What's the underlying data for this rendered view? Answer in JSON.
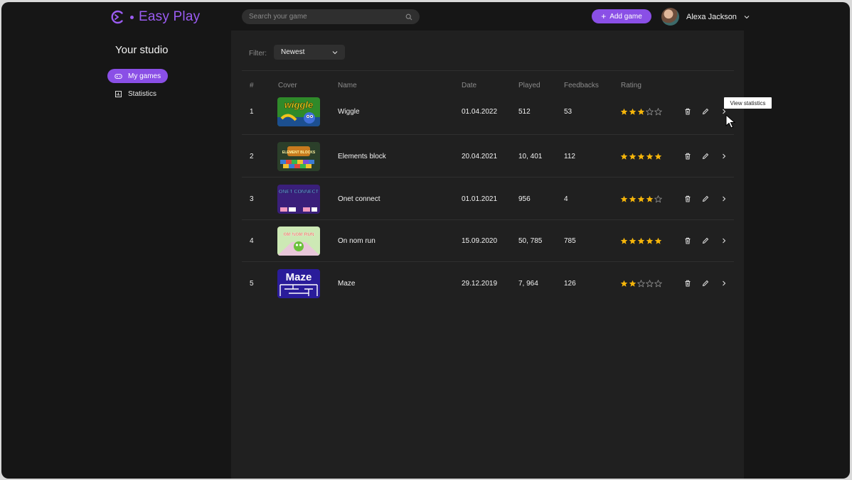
{
  "app": {
    "name": "Easy Play"
  },
  "header": {
    "search_placeholder": "Search your game",
    "add_game_label": "Add game",
    "user_name": "Alexa Jackson"
  },
  "sidebar": {
    "title": "Your studio",
    "items": [
      {
        "label": "My games",
        "icon": "gamepad-icon",
        "active": true
      },
      {
        "label": "Statistics",
        "icon": "chart-icon",
        "active": false
      }
    ]
  },
  "filter": {
    "label": "Filter:",
    "value": "Newest"
  },
  "table": {
    "columns": [
      "#",
      "Cover",
      "Name",
      "Date",
      "Played",
      "Feedbacks",
      "Rating"
    ],
    "rows": [
      {
        "num": "1",
        "name": "Wiggle",
        "date": "01.04.2022",
        "played": "512",
        "feedbacks": "53",
        "rating": 3
      },
      {
        "num": "2",
        "name": "Elements block",
        "date": "20.04.2021",
        "played": "10, 401",
        "feedbacks": "112",
        "rating": 5
      },
      {
        "num": "3",
        "name": "Onet connect",
        "date": "01.01.2021",
        "played": "956",
        "feedbacks": "4",
        "rating": 4
      },
      {
        "num": "4",
        "name": "On nom run",
        "date": "15.09.2020",
        "played": "50, 785",
        "feedbacks": "785",
        "rating": 5
      },
      {
        "num": "5",
        "name": "Maze",
        "date": "29.12.2019",
        "played": "7, 964",
        "feedbacks": "126",
        "rating": 2
      }
    ]
  },
  "covers": {
    "wiggle": "wiggle",
    "elements": "ELEMENT BLOCKS",
    "onet": "ONET CONNECT",
    "onnom": "OM NOM RUN",
    "maze": "Maze"
  },
  "tooltip": "View statistics",
  "colors": {
    "accent": "#8a4fe6",
    "star": "#f5b50a",
    "background": "#161616",
    "panel": "#202020"
  }
}
